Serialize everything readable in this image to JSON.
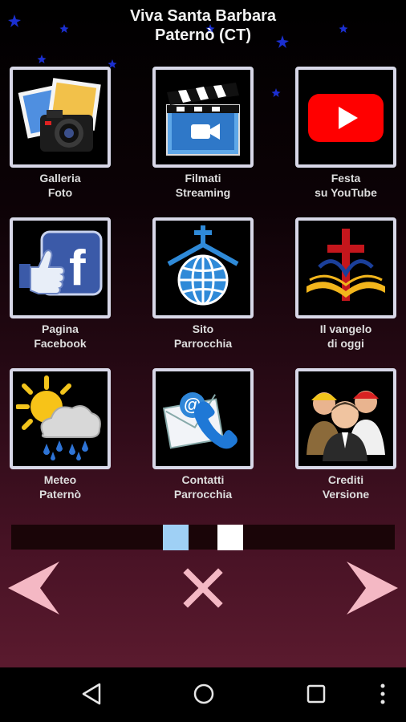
{
  "header": {
    "title_line1": "Viva Santa Barbara",
    "title_line2": "Paternò (CT)"
  },
  "tiles": [
    {
      "line1": "Galleria",
      "line2": "Foto",
      "icon": "photo-gallery-icon"
    },
    {
      "line1": "Filmati",
      "line2": "Streaming",
      "icon": "clapperboard-video-icon"
    },
    {
      "line1": "Festa",
      "line2": "su YouTube",
      "icon": "youtube-icon"
    },
    {
      "line1": "Pagina",
      "line2": "Facebook",
      "icon": "facebook-like-icon"
    },
    {
      "line1": "Sito",
      "line2": "Parrocchia",
      "icon": "church-globe-icon"
    },
    {
      "line1": "Il vangelo",
      "line2": "di oggi",
      "icon": "cross-bible-icon"
    },
    {
      "line1": "Meteo",
      "line2": "Paternò",
      "icon": "weather-icon"
    },
    {
      "line1": "Contatti",
      "line2": "Parrocchia",
      "icon": "contacts-email-phone-icon"
    },
    {
      "line1": "Crediti",
      "line2": "Versione",
      "icon": "credits-people-icon"
    }
  ],
  "pager": {
    "pages": 2,
    "active_index": 0,
    "active_color": "#9fd0f5",
    "inactive_color": "#ffffff"
  },
  "navigation": {
    "prev_icon": "left-arrow-icon",
    "close_icon": "close-icon",
    "next_icon": "right-arrow-icon",
    "accent_color": "#f4b8c4"
  },
  "system_bar": {
    "back_icon": "back-triangle-icon",
    "home_icon": "home-circle-icon",
    "recents_icon": "recents-square-icon",
    "menu_icon": "overflow-menu-icon"
  }
}
